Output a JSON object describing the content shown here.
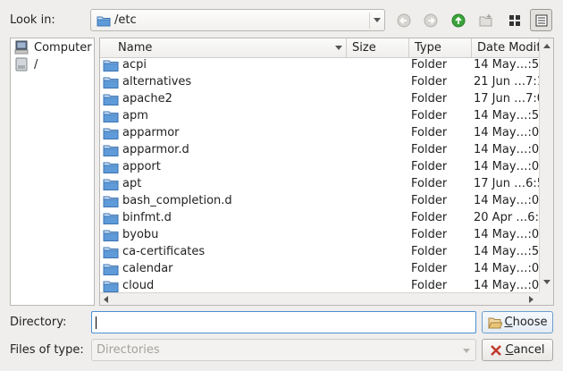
{
  "look_in": {
    "label": "Look in:",
    "path": "/etc"
  },
  "sidebar": {
    "items": [
      {
        "label": "Computer",
        "icon": "computer-icon"
      },
      {
        "label": "/",
        "icon": "drive-icon"
      }
    ]
  },
  "columns": {
    "name": "Name",
    "size": "Size",
    "type": "Type",
    "date": "Date Modifi"
  },
  "rows": [
    {
      "name": "acpi",
      "type": "Folder",
      "date": "14 May…:5"
    },
    {
      "name": "alternatives",
      "type": "Folder",
      "date": "21 Jun …7:1"
    },
    {
      "name": "apache2",
      "type": "Folder",
      "date": "17 Jun …7:0"
    },
    {
      "name": "apm",
      "type": "Folder",
      "date": "14 May…:5"
    },
    {
      "name": "apparmor",
      "type": "Folder",
      "date": "14 May…:0"
    },
    {
      "name": "apparmor.d",
      "type": "Folder",
      "date": "14 May…:0"
    },
    {
      "name": "apport",
      "type": "Folder",
      "date": "14 May…:0"
    },
    {
      "name": "apt",
      "type": "Folder",
      "date": "17 Jun …6:5"
    },
    {
      "name": "bash_completion.d",
      "type": "Folder",
      "date": "14 May…:0"
    },
    {
      "name": "binfmt.d",
      "type": "Folder",
      "date": "20 Apr …6:"
    },
    {
      "name": "byobu",
      "type": "Folder",
      "date": "14 May…:0"
    },
    {
      "name": "ca-certificates",
      "type": "Folder",
      "date": "14 May…:5"
    },
    {
      "name": "calendar",
      "type": "Folder",
      "date": "14 May…:0"
    },
    {
      "name": "cloud",
      "type": "Folder",
      "date": "14 May…:0"
    }
  ],
  "directory": {
    "label": "Directory:",
    "value": ""
  },
  "files_of_type": {
    "label": "Files of type:",
    "value": "Directories"
  },
  "buttons": {
    "choose": "Choose",
    "cancel": "Cancel"
  },
  "colors": {
    "folder": "#4a86c8",
    "accent": "#4a8fd6",
    "up_arrow": "#3aa33a",
    "cancel_x": "#c0392b"
  }
}
